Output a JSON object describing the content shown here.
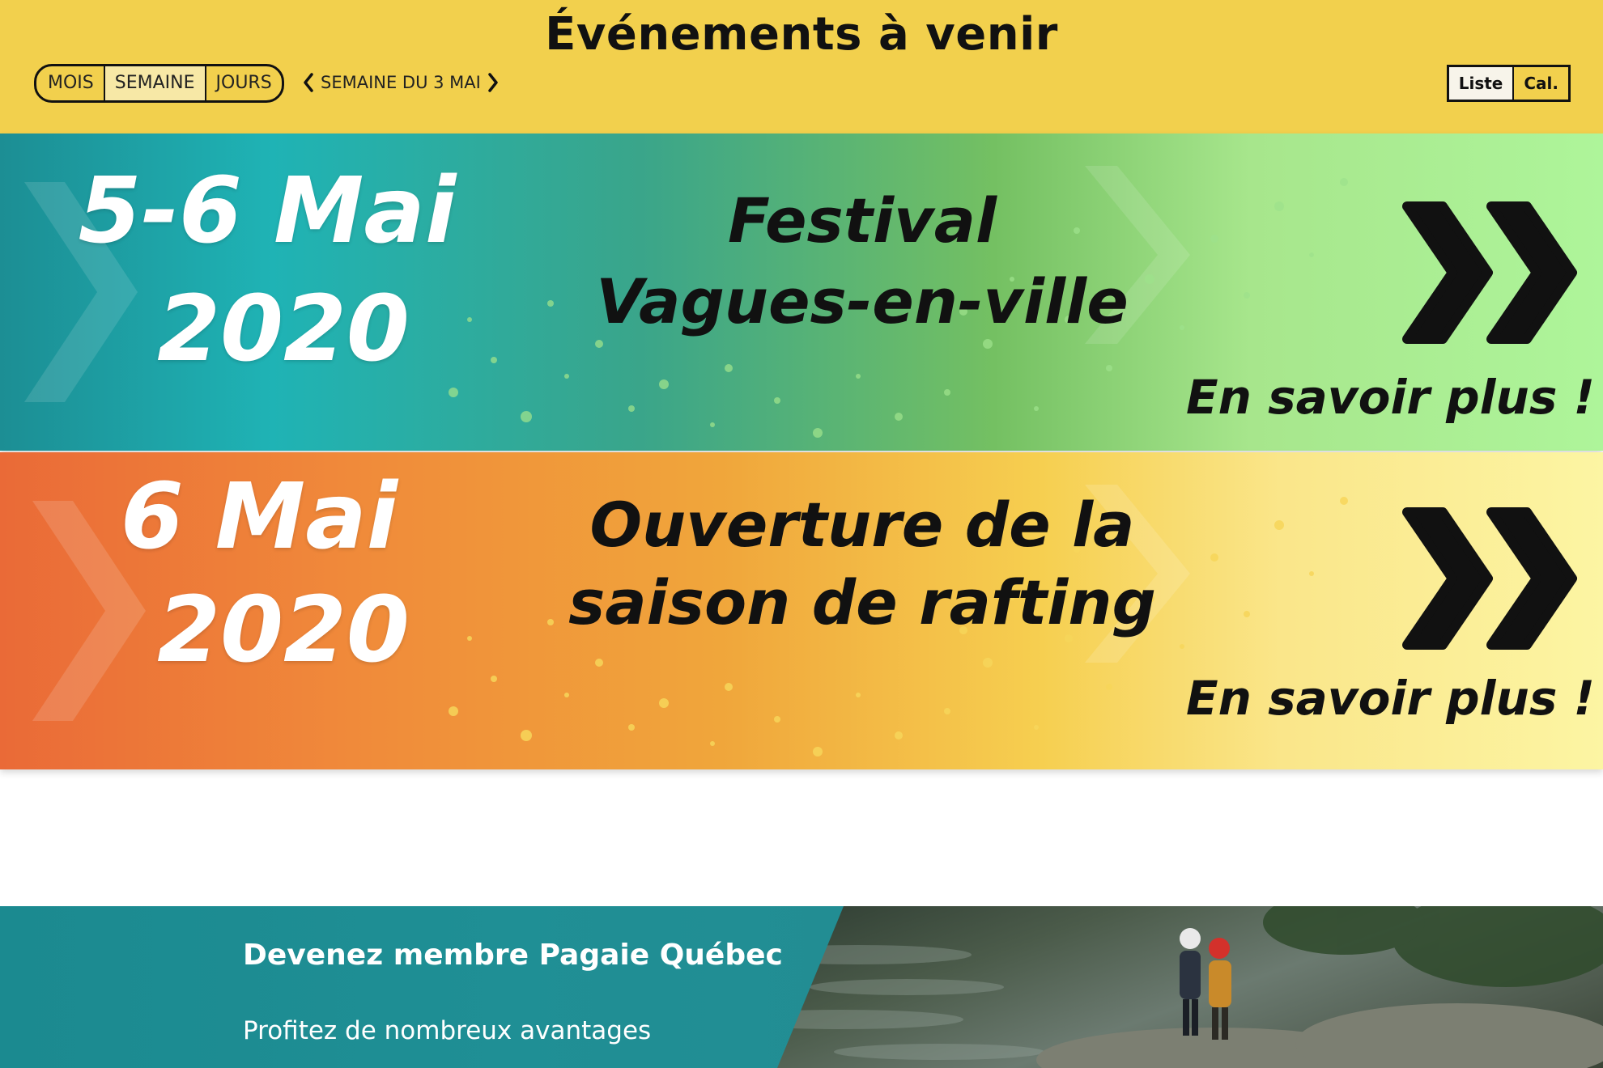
{
  "header": {
    "title": "Événements à venir",
    "view_tabs": [
      "MOIS",
      "SEMAINE",
      "JOURS"
    ],
    "active_view": "SEMAINE",
    "week_label": "SEMAINE DU 3 MAI",
    "list_label": "Liste",
    "cal_label": "Cal."
  },
  "events": [
    {
      "date_line1": "5-6 Mai",
      "date_line2": "2020",
      "title_line1": "Festival",
      "title_line2": "Vagues-en-ville",
      "more": "En savoir plus !"
    },
    {
      "date_line1": "6 Mai",
      "date_line2": "2020",
      "title_line1": "Ouverture de la",
      "title_line2": "saison de rafting",
      "more": "En savoir plus !"
    }
  ],
  "promo": {
    "title": "Devenez membre Pagaie Québec",
    "text": "Profitez de nombreux avantages"
  },
  "icons": {
    "prev": "chevron-left-icon",
    "next": "chevron-right-icon",
    "more": "double-chevron-right-icon"
  },
  "colors": {
    "header_bg": "#f2d04d",
    "event1_start": "#1c8e94",
    "event1_end": "#aef59a",
    "event2_start": "#ea6a37",
    "event2_end": "#fcf5a3",
    "promo_teal": "#1b8a90"
  }
}
